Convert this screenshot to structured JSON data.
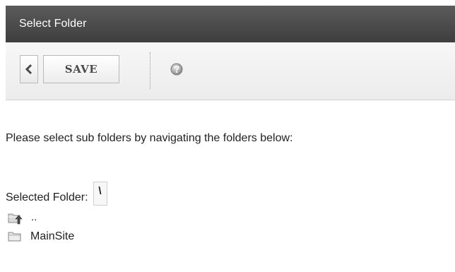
{
  "window": {
    "title": "Select Folder"
  },
  "toolbar": {
    "back_icon": "chevron-left-icon",
    "save_label": "SAVE",
    "help_icon": "help-icon"
  },
  "content": {
    "instruction": "Please select sub folders by navigating the folders below:",
    "selected_folder_label": "Selected Folder:",
    "selected_folder_value": "\\"
  },
  "folders": [
    {
      "name": "..",
      "icon": "folder-up-icon"
    },
    {
      "name": "MainSite",
      "icon": "folder-icon"
    }
  ],
  "colors": {
    "titlebar": "#4a4a4a",
    "toolbar": "#f0f0f0",
    "text": "#222222"
  }
}
